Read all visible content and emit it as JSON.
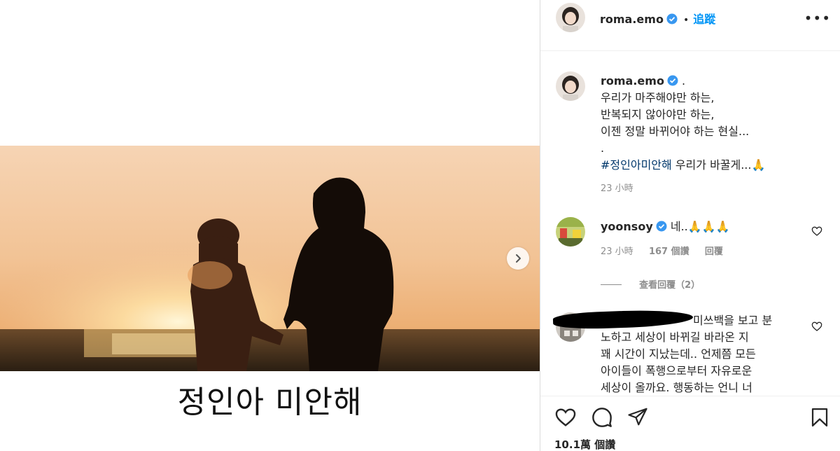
{
  "post": {
    "image_text": "정인아 미안해"
  },
  "header": {
    "username": "roma.emo",
    "follow_label": "追蹤",
    "more_label": "•••"
  },
  "caption": {
    "username": "roma.emo",
    "suffix": ".",
    "lines": [
      "우리가 마주해야만 하는,",
      "반복되지 않아야만 하는,",
      "이젠 정말 바뀌어야 하는 현실...",
      "."
    ],
    "hashtag": "#정인아미안해",
    "tail": " 우리가 바꿀게...🙏",
    "time": "23 小時"
  },
  "comment1": {
    "username": "yoonsoy",
    "text": "네..🙏🙏🙏",
    "time": "23 小時",
    "likes": "167 個讚",
    "reply_label": "回覆",
    "view_replies": "查看回覆（2）"
  },
  "comment2": {
    "lines": [
      "미쓰백을 보고 분",
      "노하고 세상이 바뀌길 바라온 지",
      "꽤 시간이 지났는데.. 언제쯤 모든",
      "아이들이 폭행으로부터 자유로운",
      "세상이 올까요. 행동하는 언니 너"
    ]
  },
  "footer": {
    "likes": "10.1萬 個讚"
  },
  "colors": {
    "accent": "#0095f6",
    "verified": "#3897f0",
    "text": "#262626",
    "muted": "#8e8e8e"
  }
}
